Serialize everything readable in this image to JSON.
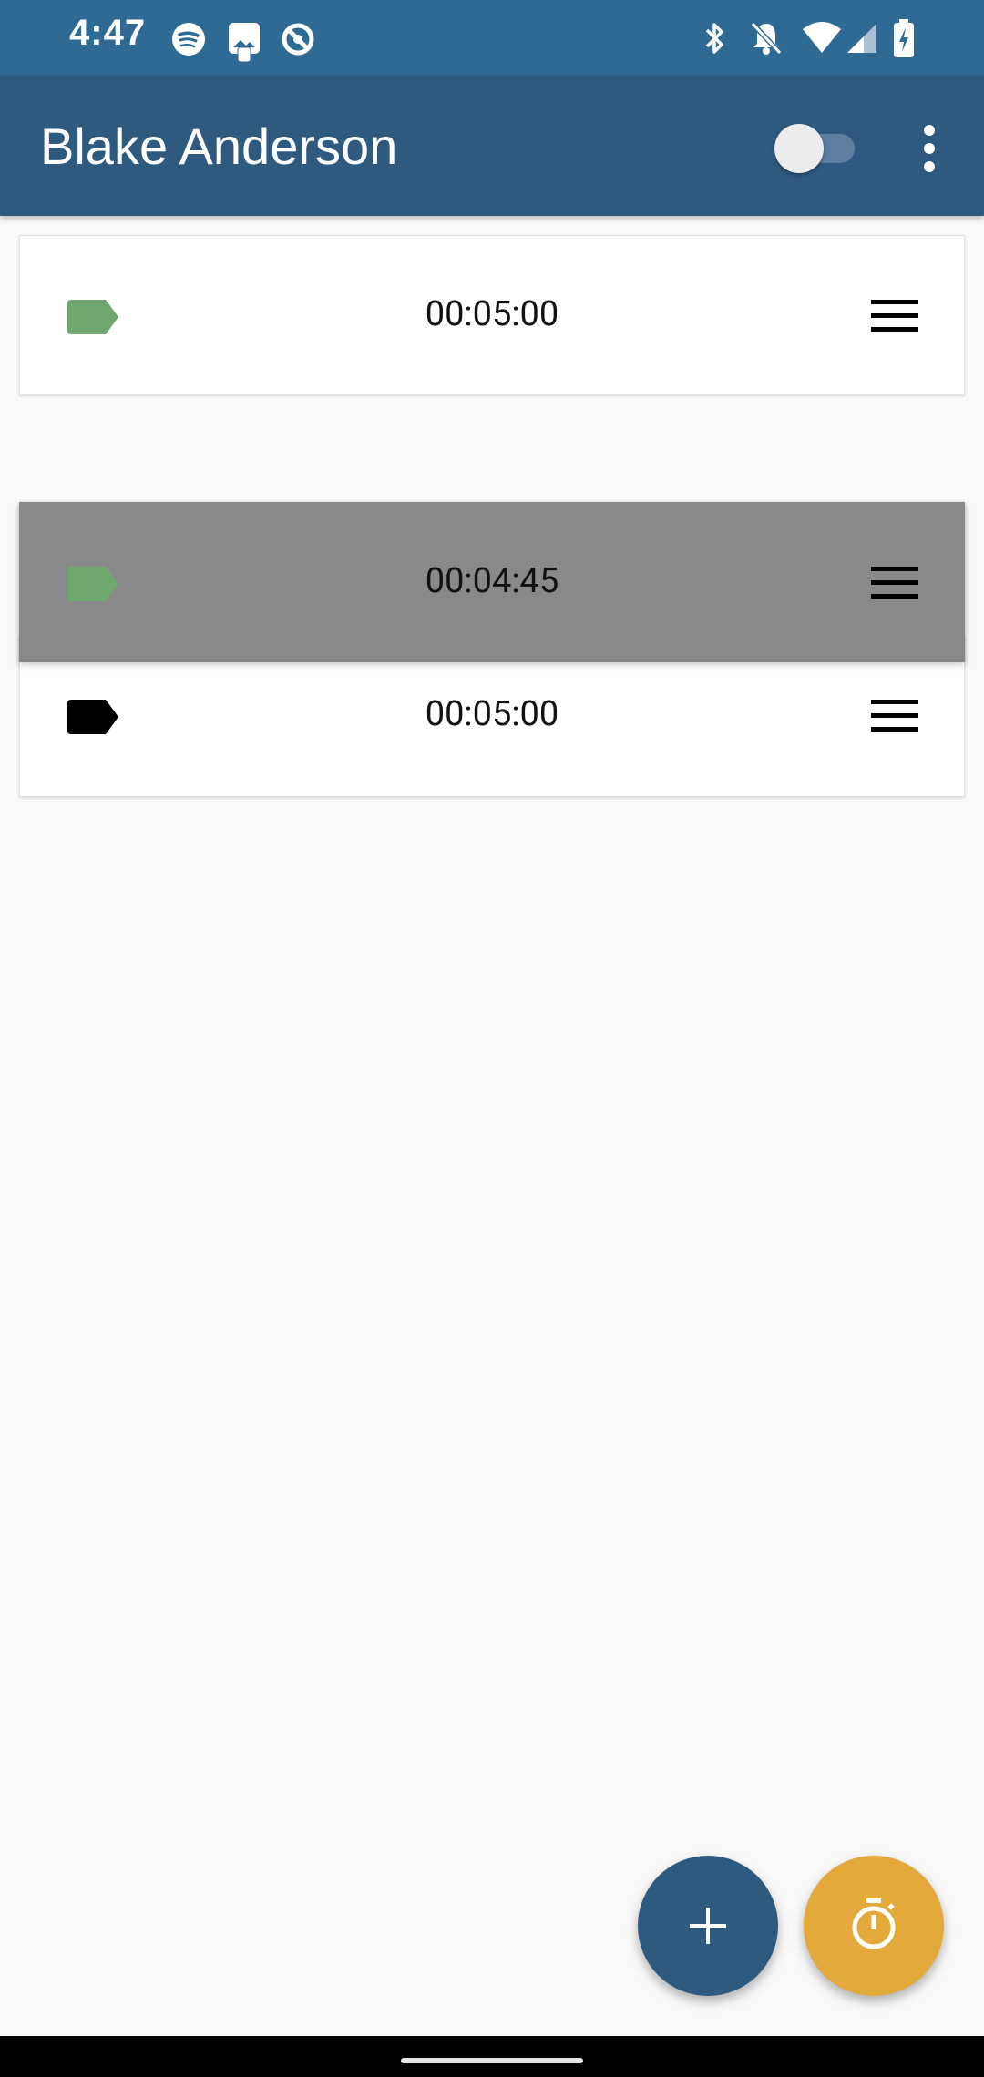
{
  "status_bar": {
    "time": "4:47",
    "left_icons": [
      "spotify-icon",
      "image-notification-icon",
      "circle-slash-icon"
    ],
    "right_icons": [
      "bluetooth-icon",
      "notifications-off-icon",
      "wifi-icon",
      "signal-icon",
      "battery-charging-icon"
    ]
  },
  "app_bar": {
    "title": "Blake Anderson",
    "toggle_on": false,
    "menu_icon": "more-vert-icon"
  },
  "timers": [
    {
      "value": "00:05:00",
      "tag_color": "#6fa86f",
      "active": false
    },
    {
      "value": "00:04:45",
      "tag_color": "#6fa86f",
      "active": true
    },
    {
      "value": "00:05:00",
      "tag_color": "#000000",
      "active": false
    }
  ],
  "fabs": {
    "add_icon": "plus-icon",
    "timer_icon": "stopwatch-icon",
    "add_color": "#2f5a80",
    "timer_color": "#e3a93a"
  },
  "colors": {
    "status_bar": "#2e6a94",
    "app_bar": "#2f5a80",
    "background": "#f9f9f9",
    "active_card": "#898989"
  }
}
